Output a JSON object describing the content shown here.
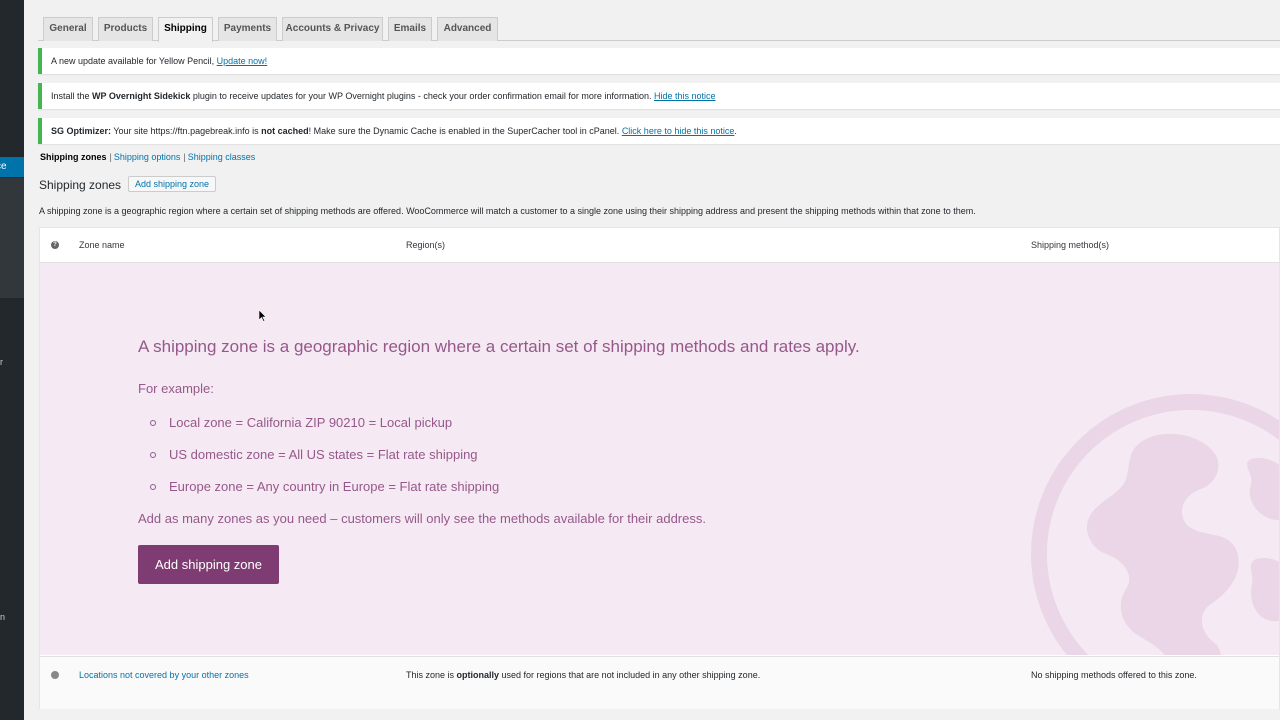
{
  "sidebar": {
    "active_fragment": "ce",
    "frag_r": "r",
    "frag_n": "n"
  },
  "tabs": [
    {
      "label": "General"
    },
    {
      "label": "Products"
    },
    {
      "label": "Shipping"
    },
    {
      "label": "Payments"
    },
    {
      "label": "Accounts & Privacy"
    },
    {
      "label": "Emails"
    },
    {
      "label": "Advanced"
    }
  ],
  "notices": {
    "update": {
      "text": "A new update available for Yellow Pencil, ",
      "link": "Update now!"
    },
    "sidekick": {
      "pre": "Install the ",
      "bold": "WP Overnight Sidekick",
      "post": " plugin to receive updates for your WP Overnight plugins - check your order confirmation email for more information. ",
      "link": "Hide this notice"
    },
    "sg": {
      "bold1": "SG Optimizer:",
      "pre": " Your site https://ftn.pagebreak.info is ",
      "bold2": "not cached",
      "post": "! Make sure the Dynamic Cache is enabled in the SuperCacher tool in cPanel. ",
      "link": "Click here to hide this notice",
      "end": "."
    }
  },
  "subnav": {
    "current": "Shipping zones",
    "options": "Shipping options",
    "classes": "Shipping classes",
    "sep": "|"
  },
  "heading": {
    "title": "Shipping zones",
    "add_button": "Add shipping zone"
  },
  "description": "A shipping zone is a geographic region where a certain set of shipping methods are offered. WooCommerce will match a customer to a single zone using their shipping address and present the shipping methods within that zone to them.",
  "table": {
    "headers": {
      "help": "?",
      "zone_name": "Zone name",
      "regions": "Region(s)",
      "methods": "Shipping method(s)"
    },
    "blank_state": {
      "lead": "A shipping zone is a geographic region where a certain set of shipping methods and rates apply.",
      "example_label": "For example:",
      "examples": [
        "Local zone = California ZIP 90210 = Local pickup",
        "US domestic zone = All US states = Flat rate shipping",
        "Europe zone = Any country in Europe = Flat rate shipping"
      ],
      "more": "Add as many zones as you need – customers will only see the methods available for their address.",
      "cta": "Add shipping zone"
    },
    "rest_of_world": {
      "name": "Locations not covered by your other zones",
      "regions_pre": "This zone is ",
      "regions_bold": "optionally",
      "regions_post": " used for regions that are not included in any other shipping zone.",
      "methods": "No shipping methods offered to this zone."
    }
  },
  "colors": {
    "accent": "#96588a",
    "cta": "#7e3c72",
    "notice_border": "#46b450",
    "link": "#0073aa"
  }
}
